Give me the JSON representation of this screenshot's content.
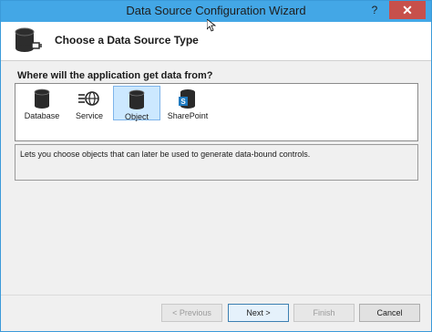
{
  "window": {
    "title": "Data Source Configuration Wizard",
    "help_label": "?",
    "close_label": "✕"
  },
  "header": {
    "title": "Choose a Data Source Type"
  },
  "main": {
    "question": "Where will the application get data from?",
    "sources": [
      {
        "label": "Database",
        "icon": "database-icon",
        "selected": false
      },
      {
        "label": "Service",
        "icon": "service-icon",
        "selected": false
      },
      {
        "label": "Object",
        "icon": "object-icon",
        "selected": true
      },
      {
        "label": "SharePoint",
        "icon": "sharepoint-icon",
        "selected": false
      }
    ],
    "description": "Lets you choose objects that can later be used to generate data-bound controls."
  },
  "footer": {
    "previous_label": "< Previous",
    "next_label": "Next >",
    "finish_label": "Finish",
    "cancel_label": "Cancel"
  },
  "colors": {
    "titlebar": "#43a7e6",
    "close": "#c7504b",
    "selection": "#cce8ff"
  }
}
